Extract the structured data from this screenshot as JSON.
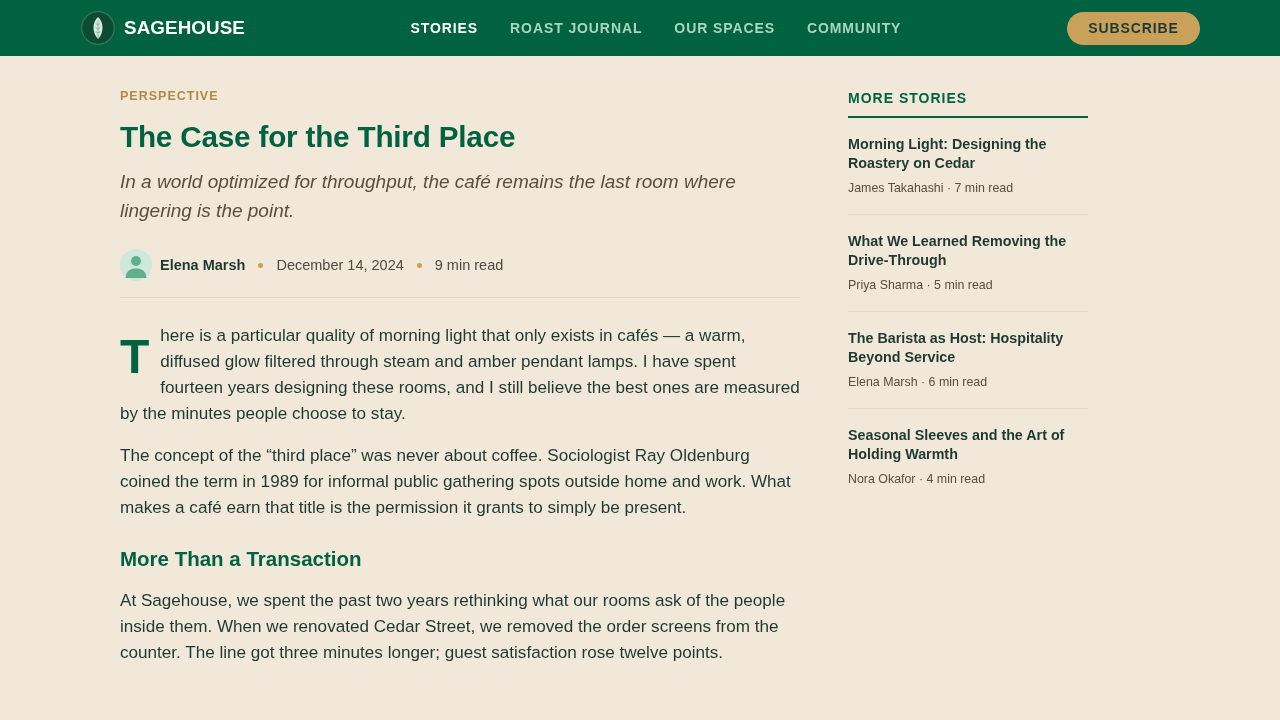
{
  "header": {
    "brand": "SAGEHOUSE",
    "nav": [
      {
        "label": "STORIES",
        "selected": true
      },
      {
        "label": "ROAST JOURNAL",
        "selected": false
      },
      {
        "label": "OUR SPACES",
        "selected": false
      },
      {
        "label": "COMMUNITY",
        "selected": false
      }
    ],
    "subscribe_button": "SUBSCRIBE"
  },
  "article": {
    "kicker": "PERSPECTIVE",
    "title": "The Case for the Third Place",
    "subtitle": "In a world optimized for throughput, the café remains the last room where lingering is the point.",
    "byline": {
      "author": "Elena Marsh",
      "date": "December 14, 2024",
      "read_time": "9 min read"
    },
    "body": [
      {
        "kind": "paragraph",
        "drop_cap": true,
        "text": "There is a particular quality of morning light that only exists in cafés — a warm, diffused glow filtered through steam and amber pendant lamps. I have spent fourteen years designing these rooms, and I still believe the best ones are measured by the minutes people choose to stay."
      },
      {
        "kind": "paragraph",
        "drop_cap": false,
        "text": "The concept of the “third place” was never about coffee. Sociologist Ray Oldenburg coined the term in 1989 for informal public gathering spots outside home and work. What makes a café earn that title is the permission it grants to simply be present."
      },
      {
        "kind": "heading",
        "text": "More Than a Transaction"
      },
      {
        "kind": "paragraph",
        "drop_cap": false,
        "text": "At Sagehouse, we spent the past two years rethinking what our rooms ask of the people inside them. When we renovated Cedar Street, we removed the order screens from the counter. The line got three minutes longer; guest satisfaction rose twelve points."
      }
    ]
  },
  "sidebar": {
    "title": "MORE STORIES",
    "stories": [
      {
        "title": "Morning Light: Designing the Roastery on Cedar",
        "meta": "James Takahashi · 7 min read"
      },
      {
        "title": "What We Learned Removing the Drive-Through",
        "meta": "Priya Sharma · 5 min read"
      },
      {
        "title": "The Barista as Host: Hospitality Beyond Service",
        "meta": "Elena Marsh · 6 min read"
      },
      {
        "title": "Seasonal Sleeves and the Art of Holding Warmth",
        "meta": "Nora Okafor · 4 min read"
      }
    ]
  }
}
